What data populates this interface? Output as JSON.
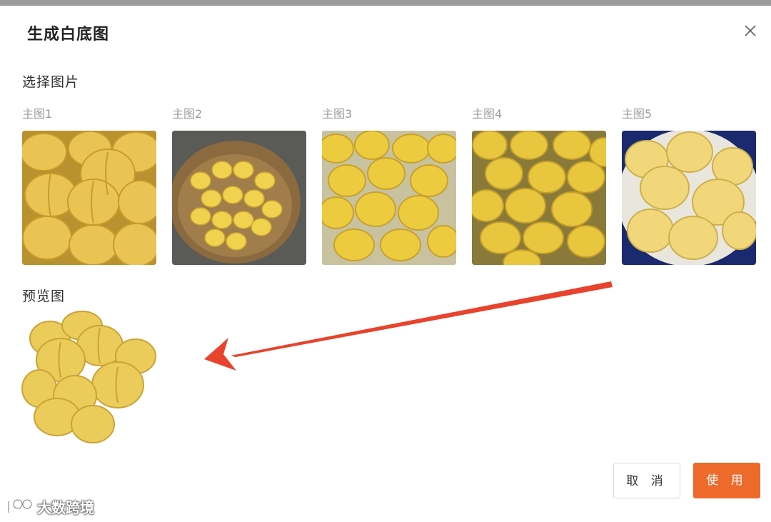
{
  "dialog": {
    "title": "生成白底图",
    "close_icon": "close-icon"
  },
  "select_section": {
    "label": "选择图片",
    "thumbnails": [
      {
        "label": "主图1",
        "image": "yellow peaches close-up pile"
      },
      {
        "label": "主图2",
        "image": "basket of yellow flat peaches"
      },
      {
        "label": "主图3",
        "image": "yellow flat peaches on cloth"
      },
      {
        "label": "主图4",
        "image": "heap of yellow flat peaches"
      },
      {
        "label": "主图5",
        "image": "yellow flat peaches on blue plate"
      }
    ]
  },
  "preview_section": {
    "label": "预览图",
    "image": "white-background cutout of yellow flat peaches"
  },
  "annotation": {
    "arrow_color": "#e8432c"
  },
  "footer": {
    "cancel_label": "取 消",
    "use_label": "使 用"
  },
  "watermark": {
    "text": "大数跨境"
  },
  "colors": {
    "accent": "#ee6a2b",
    "peach": "#e8c24a"
  }
}
